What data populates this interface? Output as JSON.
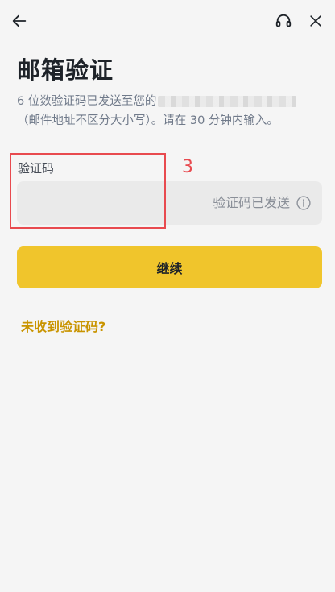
{
  "header": {
    "back_icon": "arrow-left-icon",
    "support_icon": "headset-icon",
    "close_icon": "close-icon"
  },
  "page": {
    "title": "邮箱验证",
    "desc_line1": "6 位数验证码已发送至您的",
    "desc_line2": "（邮件地址不区分大小写）。请在 30 分钟内输入。"
  },
  "form": {
    "field_label": "验证码",
    "input_value": "",
    "sent_status": "验证码已发送",
    "info_icon": "info-icon"
  },
  "annotation": {
    "number": "3",
    "color": "#e84a4f"
  },
  "actions": {
    "continue_label": "继续",
    "not_received_label": "未收到验证码?"
  },
  "colors": {
    "accent": "#f0c52c",
    "link": "#c99400",
    "background": "#f5f5f5"
  }
}
